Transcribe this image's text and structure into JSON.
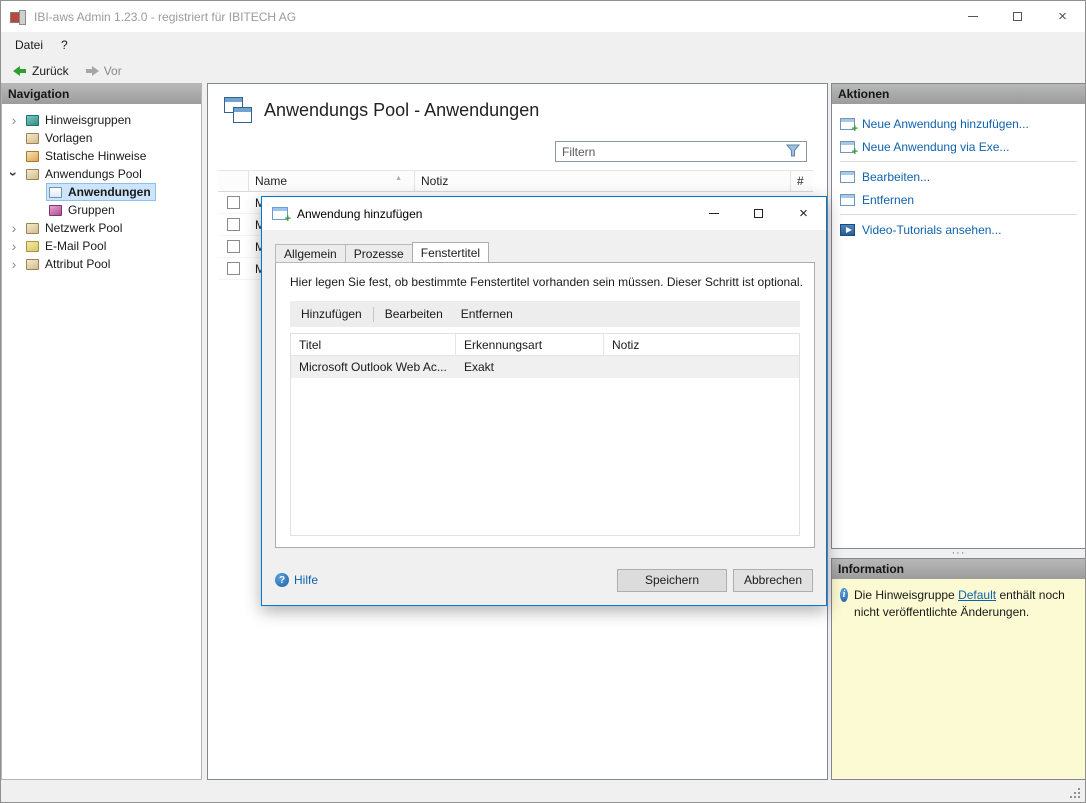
{
  "colors": {
    "accent": "#0078d7",
    "link": "#0f62ac",
    "selection": "#cde5fa",
    "info-bg": "#fbfad2"
  },
  "window": {
    "title": "IBI-aws Admin 1.23.0 - registriert für IBITECH AG"
  },
  "icons": {
    "close_glyph": "×",
    "sort_asc_glyph": "▲",
    "chevron_glyph": "›",
    "splitter_glyph": "···",
    "help_glyph": "?",
    "info_glyph": "i"
  },
  "menubar": {
    "items": [
      {
        "label": "Datei"
      },
      {
        "label": "?"
      }
    ]
  },
  "toolbar": {
    "back_label": "Zurück",
    "forward_label": "Vor"
  },
  "navigation": {
    "header": "Navigation",
    "items": [
      {
        "label": "Hinweisgruppen"
      },
      {
        "label": "Vorlagen"
      },
      {
        "label": "Statische Hinweise"
      },
      {
        "label": "Anwendungs Pool"
      },
      {
        "label": "Anwendungen"
      },
      {
        "label": "Gruppen"
      },
      {
        "label": "Netzwerk Pool"
      },
      {
        "label": "E-Mail Pool"
      },
      {
        "label": "Attribut Pool"
      }
    ]
  },
  "main": {
    "title": "Anwendungs Pool - Anwendungen",
    "filter_placeholder": "Filtern",
    "columns": [
      "Name",
      "Notiz",
      "#"
    ],
    "rows": [
      {
        "name": "M"
      },
      {
        "name": "M"
      },
      {
        "name": "M"
      },
      {
        "name": "M"
      }
    ]
  },
  "dialog": {
    "title": "Anwendung hinzufügen",
    "tabs": [
      {
        "label": "Allgemein"
      },
      {
        "label": "Prozesse"
      },
      {
        "label": "Fenstertitel"
      }
    ],
    "description": "Hier legen Sie fest, ob bestimmte Fenstertitel vorhanden sein müssen. Dieser Schritt ist optional.",
    "toolbar": [
      {
        "label": "Hinzufügen"
      },
      {
        "label": "Bearbeiten"
      },
      {
        "label": "Entfernen"
      }
    ],
    "table": {
      "columns": [
        "Titel",
        "Erkennungsart",
        "Notiz"
      ],
      "rows": [
        {
          "titel": "Microsoft Outlook Web Ac...",
          "erkennungsart": "Exakt",
          "notiz": ""
        }
      ]
    },
    "help_label": "Hilfe",
    "save_label": "Speichern",
    "cancel_label": "Abbrechen"
  },
  "actions": {
    "header": "Aktionen",
    "items": [
      {
        "label": "Neue Anwendung hinzufügen..."
      },
      {
        "label": "Neue Anwendung via Exe..."
      },
      {
        "label": "Bearbeiten..."
      },
      {
        "label": "Entfernen"
      },
      {
        "label": "Video-Tutorials ansehen..."
      }
    ]
  },
  "information": {
    "header": "Information",
    "message_prefix": "Die Hinweisgruppe ",
    "link_label": "Default",
    "message_suffix": " enthält noch nicht veröffentlichte Änderungen."
  }
}
